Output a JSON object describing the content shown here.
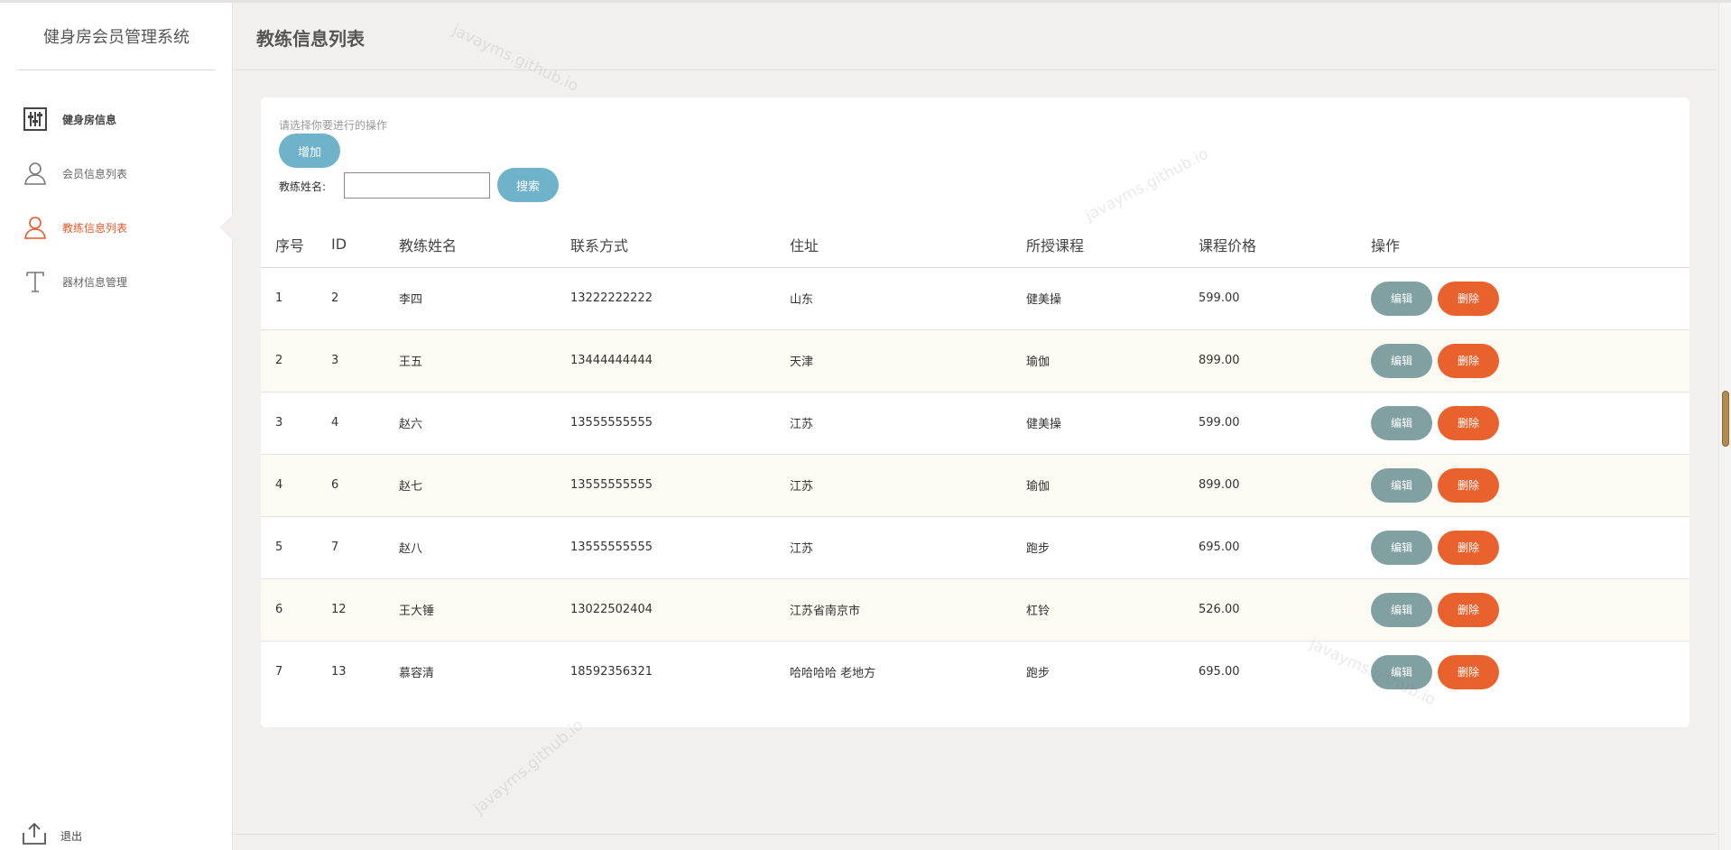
{
  "app": {
    "brand": "健身房会员管理系统",
    "page_title": "教练信息列表"
  },
  "sidebar": {
    "items": [
      {
        "label": "健身房信息",
        "icon": "sliders-icon"
      },
      {
        "label": "会员信息列表",
        "icon": "user-icon"
      },
      {
        "label": "教练信息列表",
        "icon": "user-icon"
      },
      {
        "label": "器材信息管理",
        "icon": "text-icon"
      }
    ],
    "active_index": 2,
    "logout_label": "退出"
  },
  "toolbar": {
    "hint": "请选择你要进行的操作",
    "add_label": "增加",
    "search_label": "教练姓名:",
    "search_value": "",
    "search_button": "搜索"
  },
  "table": {
    "headers": [
      "序号",
      "ID",
      "教练姓名",
      "联系方式",
      "住址",
      "所授课程",
      "课程价格",
      "操作"
    ],
    "rows": [
      {
        "no": "1",
        "id": "2",
        "name": "李四",
        "phone": "13222222222",
        "address": "山东",
        "course": "健美操",
        "price": "599.00"
      },
      {
        "no": "2",
        "id": "3",
        "name": "王五",
        "phone": "13444444444",
        "address": "天津",
        "course": "瑜伽",
        "price": "899.00"
      },
      {
        "no": "3",
        "id": "4",
        "name": "赵六",
        "phone": "13555555555",
        "address": "江苏",
        "course": "健美操",
        "price": "599.00"
      },
      {
        "no": "4",
        "id": "6",
        "name": "赵七",
        "phone": "13555555555",
        "address": "江苏",
        "course": "瑜伽",
        "price": "899.00"
      },
      {
        "no": "5",
        "id": "7",
        "name": "赵八",
        "phone": "13555555555",
        "address": "江苏",
        "course": "跑步",
        "price": "695.00"
      },
      {
        "no": "6",
        "id": "12",
        "name": "王大锤",
        "phone": "13022502404",
        "address": "江苏省南京市",
        "course": "杠铃",
        "price": "526.00"
      },
      {
        "no": "7",
        "id": "13",
        "name": "慕容清",
        "phone": "18592356321",
        "address": "哈哈哈哈 老地方",
        "course": "跑步",
        "price": "695.00"
      }
    ],
    "edit_label": "编辑",
    "delete_label": "删除"
  },
  "watermark": "javayms.github.io",
  "colors": {
    "accent": "#e8572a",
    "info": "#6fb3cb",
    "edit": "#80a0a2",
    "delete": "#e9622d"
  }
}
